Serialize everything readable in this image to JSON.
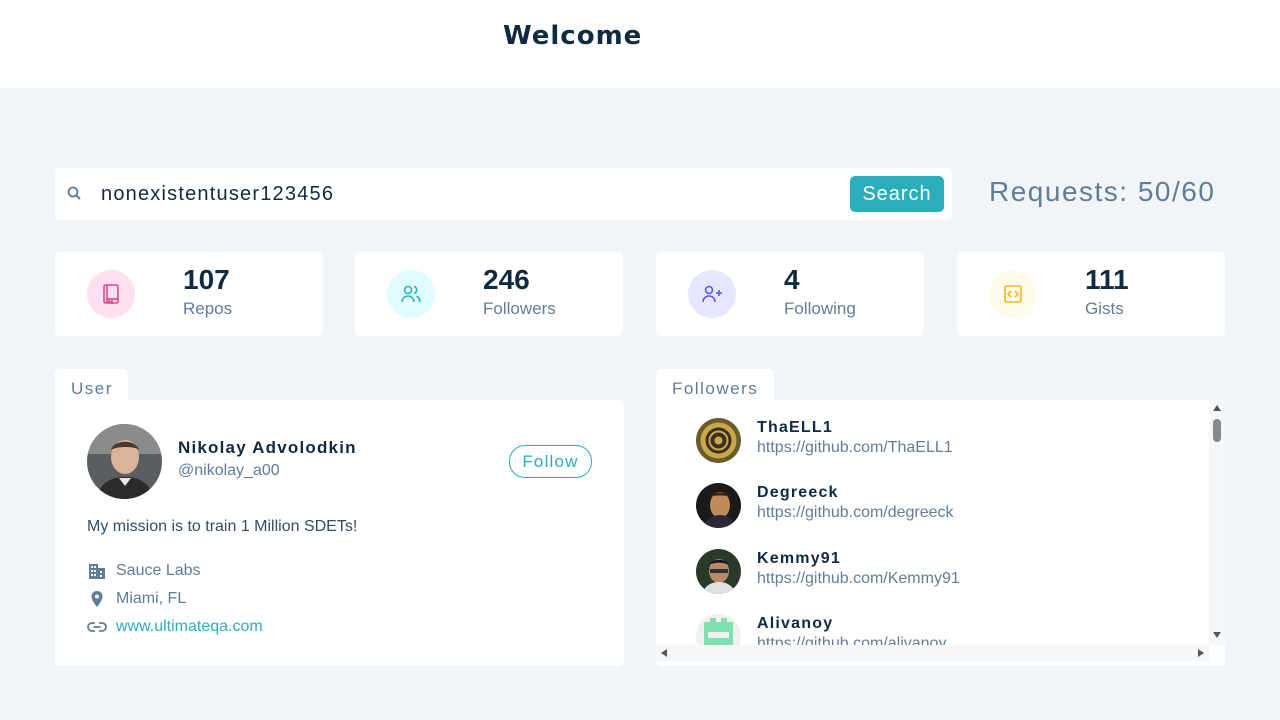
{
  "header": {
    "title": "Welcome"
  },
  "search": {
    "value": "nonexistentuser123456",
    "button_label": "Search"
  },
  "requests": {
    "text": "Requests: 50/60"
  },
  "stats": [
    {
      "value": "107",
      "label": "Repos",
      "icon": "book-icon",
      "color": "#da4a91",
      "bg": "#ffe0f0"
    },
    {
      "value": "246",
      "label": "Followers",
      "icon": "users-icon",
      "color": "#2caeba",
      "bg": "#e0fcff"
    },
    {
      "value": "4",
      "label": "Following",
      "icon": "user-plus-icon",
      "color": "#5d55fa",
      "bg": "#e6e6ff"
    },
    {
      "value": "111",
      "label": "Gists",
      "icon": "code-icon",
      "color": "#f0b429",
      "bg": "#fffbea"
    }
  ],
  "user_card": {
    "tab_label": "User",
    "name": "Nikolay Advolodkin",
    "handle": "@nikolay_a00",
    "follow_label": "Follow",
    "bio": "My mission is to train 1 Million SDETs!",
    "company": "Sauce Labs",
    "location": "Miami, FL",
    "blog": "www.ultimateqa.com"
  },
  "followers_card": {
    "tab_label": "Followers",
    "items": [
      {
        "name": "ThaELL1",
        "url": "https://github.com/ThaELL1"
      },
      {
        "name": "Degreeck",
        "url": "https://github.com/degreeck"
      },
      {
        "name": "Kemmy91",
        "url": "https://github.com/Kemmy91"
      },
      {
        "name": "Alivanoy",
        "url": "https://github.com/alivanoy"
      }
    ]
  }
}
